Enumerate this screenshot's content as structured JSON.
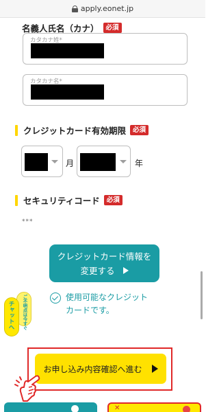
{
  "browser": {
    "url": "apply.eonet.jp",
    "icon": "lock-icon"
  },
  "form": {
    "name_kana": {
      "label": "名義人氏名（カナ）",
      "required_badge": "必須",
      "last_name_placeholder": "カタカナ姓*",
      "first_name_placeholder": "カタカナ名*"
    },
    "expiry": {
      "label": "クレジットカード有効期限",
      "required_badge": "必須",
      "month_unit": "月",
      "year_unit": "年"
    },
    "security_code": {
      "label": "セキュリティコード",
      "required_badge": "必須",
      "value": "***"
    }
  },
  "card_change": {
    "button_line1": "クレジットカード情報を",
    "button_line2": "変更する",
    "note_line1": "使用可能なクレジット",
    "note_line2": "カードです。",
    "icon": "check-circle-icon"
  },
  "chat_tab": {
    "small_label": "ご不明点は今すぐ",
    "big_label": "チャットへ"
  },
  "proceed": {
    "label": "お申し込み内容確認へ進む"
  },
  "colors": {
    "accent_teal": "#1a9ca4",
    "button_yellow": "#ffe100",
    "required_red": "#d42b2b",
    "highlight_red": "#e02828"
  }
}
